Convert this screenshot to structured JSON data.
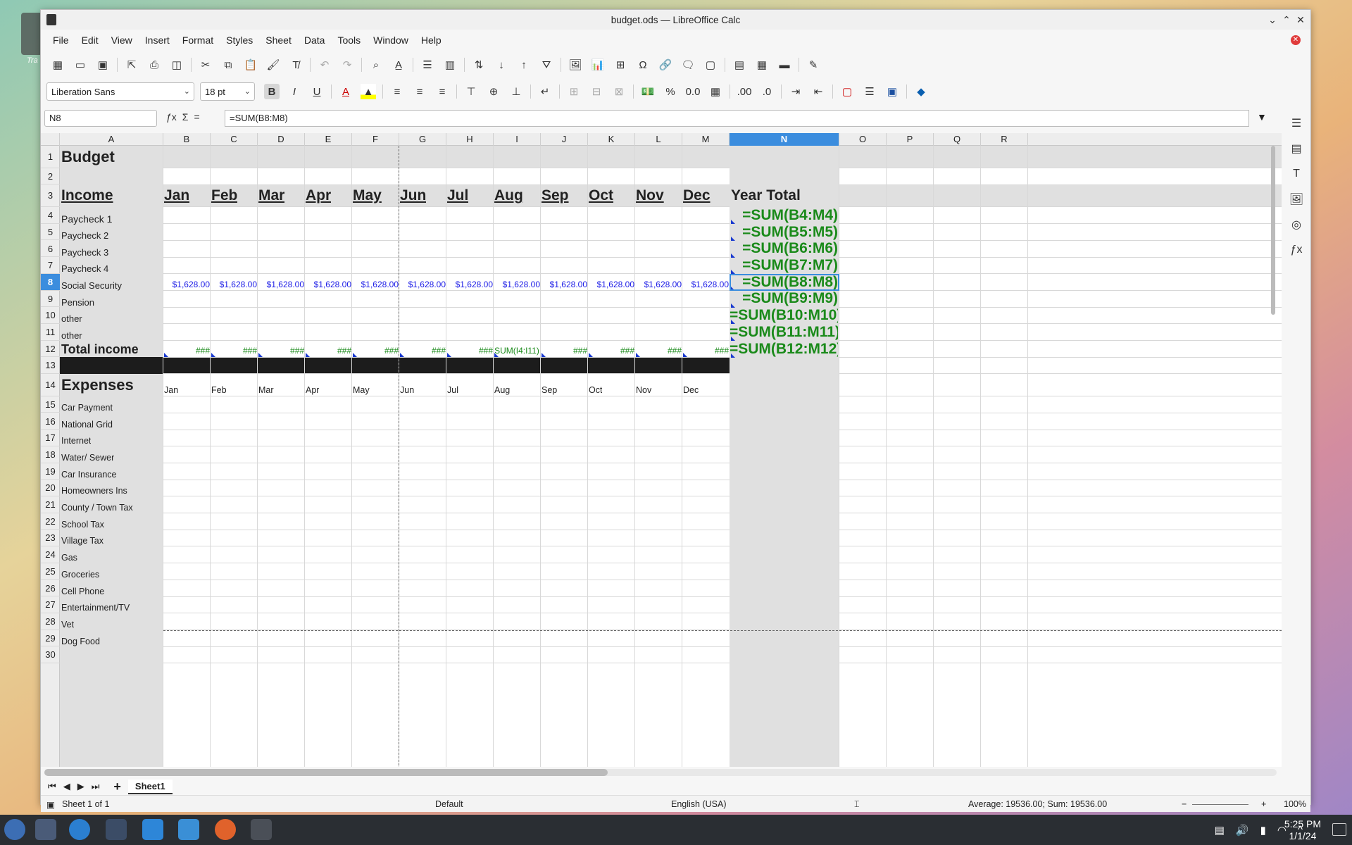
{
  "window": {
    "title": "budget.ods — LibreOffice Calc"
  },
  "desktop": {
    "icon_label": "Tra"
  },
  "menu": [
    "File",
    "Edit",
    "View",
    "Insert",
    "Format",
    "Styles",
    "Sheet",
    "Data",
    "Tools",
    "Window",
    "Help"
  ],
  "formatting": {
    "font_name": "Liberation Sans",
    "font_size": "18 pt"
  },
  "formula_bar": {
    "cell_ref": "N8",
    "formula": "=SUM(B8:M8)",
    "equals": "="
  },
  "columns": [
    "A",
    "B",
    "C",
    "D",
    "E",
    "F",
    "G",
    "H",
    "I",
    "J",
    "K",
    "L",
    "M",
    "N",
    "O",
    "P",
    "Q",
    "R"
  ],
  "selected_column": "N",
  "rows": [
    "1",
    "2",
    "3",
    "4",
    "5",
    "6",
    "7",
    "8",
    "9",
    "10",
    "11",
    "12",
    "13",
    "14",
    "15",
    "16",
    "17",
    "18",
    "19",
    "20",
    "21",
    "22",
    "23",
    "24",
    "25",
    "26",
    "27",
    "28",
    "29",
    "30"
  ],
  "selected_row": "8",
  "sheet": {
    "title": "Budget",
    "income_label": "Income",
    "year_total_label": "Year Total",
    "months": [
      "Jan",
      "Feb",
      "Mar",
      "Apr",
      "May",
      "Jun",
      "Jul",
      "Aug",
      "Sep",
      "Oct",
      "Nov",
      "Dec"
    ],
    "income_rows": [
      "Paycheck 1",
      "Paycheck 2",
      "Paycheck 3",
      "Paycheck  4",
      "Social Security",
      "Pension",
      "other",
      "other"
    ],
    "social_security_values": [
      "$1,628.00",
      "$1,628.00",
      "$1,628.00",
      "$1,628.00",
      "$1,628.00",
      "$1,628.00",
      "$1,628.00",
      "$1,628.00",
      "$1,628.00",
      "$1,628.00",
      "$1,628.00",
      "$1,628.00"
    ],
    "year_totals": [
      "=SUM(B4:M4)",
      "=SUM(B5:M5)",
      "=SUM(B6:M6)",
      "=SUM(B7:M7)",
      "=SUM(B8:M8)",
      "=SUM(B9:M9)",
      "=SUM(B10:M10)",
      "=SUM(B11:M11)",
      "=SUM(B12:M12)"
    ],
    "total_income_label": "Total income",
    "total_income_values": [
      "###",
      "###",
      "###",
      "###",
      "###",
      "###",
      "###",
      "SUM(I4:I11)",
      "###",
      "###",
      "###",
      "###"
    ],
    "expenses_label": "Expenses",
    "expense_rows": [
      "Car Payment",
      "National Grid",
      "Internet",
      "Water/ Sewer",
      "Car Insurance",
      "Homeowners Ins",
      "County / Town Tax",
      "School Tax",
      "Village Tax",
      "Gas",
      "Groceries",
      "Cell Phone",
      "Entertainment/TV",
      "Vet",
      "Dog Food"
    ]
  },
  "tabs": {
    "sheet_name": "Sheet1",
    "add_label": "+"
  },
  "status": {
    "sheet_info": "Sheet 1 of 1",
    "page_style": "Default",
    "language": "English (USA)",
    "selection": "Average: 19536.00; Sum: 19536.00",
    "zoom": "100%"
  },
  "clock": {
    "time": "5:25 PM",
    "date": "1/1/24"
  },
  "colors": {
    "accent": "#3b8dde",
    "green_text": "#1a8a1a",
    "blue_text": "#1a1ae6"
  }
}
